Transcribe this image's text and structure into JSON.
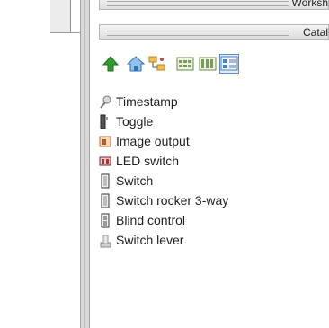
{
  "panels": {
    "workspace_title": "Worksh",
    "catalog_title": "Catal"
  },
  "toolbar": {
    "buttons": [
      {
        "icon": "up-arrow-icon",
        "color": "#2e9e2e"
      },
      {
        "icon": "home-icon",
        "color": "#3f8fd6"
      },
      {
        "icon": "tree-view-icon",
        "color": "#e2a733"
      },
      {
        "icon": "large-icons-view-icon",
        "color": "#7a9c5a"
      },
      {
        "icon": "small-icons-view-icon",
        "color": "#7a9c5a"
      },
      {
        "icon": "details-view-icon",
        "color": "#4a7fc0",
        "selected": true
      }
    ]
  },
  "catalog": {
    "items": [
      {
        "label": "Timestamp",
        "icon": "timestamp-icon"
      },
      {
        "label": "Toggle",
        "icon": "toggle-icon"
      },
      {
        "label": "Image output",
        "icon": "image-output-icon"
      },
      {
        "label": "LED switch",
        "icon": "led-switch-icon"
      },
      {
        "label": "Switch",
        "icon": "switch-icon"
      },
      {
        "label": "Switch rocker 3-way",
        "icon": "switch-rocker-icon"
      },
      {
        "label": "Blind control",
        "icon": "blind-control-icon"
      },
      {
        "label": "Switch lever",
        "icon": "switch-lever-icon"
      }
    ]
  }
}
